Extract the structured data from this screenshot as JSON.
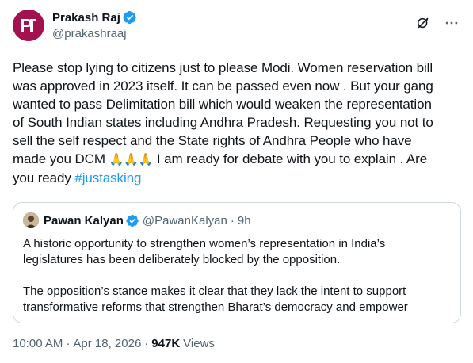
{
  "author": {
    "display_name": "Prakash Raj",
    "handle": "@prakashraaj",
    "verified": true,
    "avatar_color": "#a3124e"
  },
  "tweet": {
    "lines": [
      "Please stop lying to citizens just to please Modi. Women reservation bill",
      "was approved in 2023 itself.  It can be passed even now . But your gang",
      "wanted to pass Delimitation bill which would weaken the representation",
      "of South Indian states including Andhra Pradesh. Requesting you not to",
      "sell the self respect and the State rights of Andhra People who have"
    ],
    "line6_before_emoji": "made you DCM ",
    "emoji": "🙏🙏🙏",
    "line6_after_emoji": " I am ready for debate with you to explain . Are",
    "line7_text": "you ready ",
    "hashtag": "#justasking"
  },
  "quote": {
    "display_name": "Pawan Kalyan",
    "handle": "@PawanKalyan",
    "dot": "·",
    "time": "9h",
    "paragraph1": [
      "A historic opportunity to strengthen women’s representation in India’s",
      "legislatures has been deliberately blocked by the opposition."
    ],
    "paragraph2": [
      "The opposition’s stance makes it clear that they lack the intent to support",
      "transformative reforms that strengthen Bharat’s democracy and empower"
    ]
  },
  "meta": {
    "time": "10:00 AM",
    "sep": "·",
    "date": "Apr 18, 2026",
    "sep2": "·",
    "views_count": "947K",
    "views_label": "Views"
  },
  "colors": {
    "link": "#1d9bf0",
    "muted": "#536471",
    "text": "#0f1419",
    "border": "#cfd9de",
    "verified": "#1d9bf0"
  },
  "icons": [
    "verified-badge-icon",
    "grok-icon",
    "more-icon"
  ]
}
